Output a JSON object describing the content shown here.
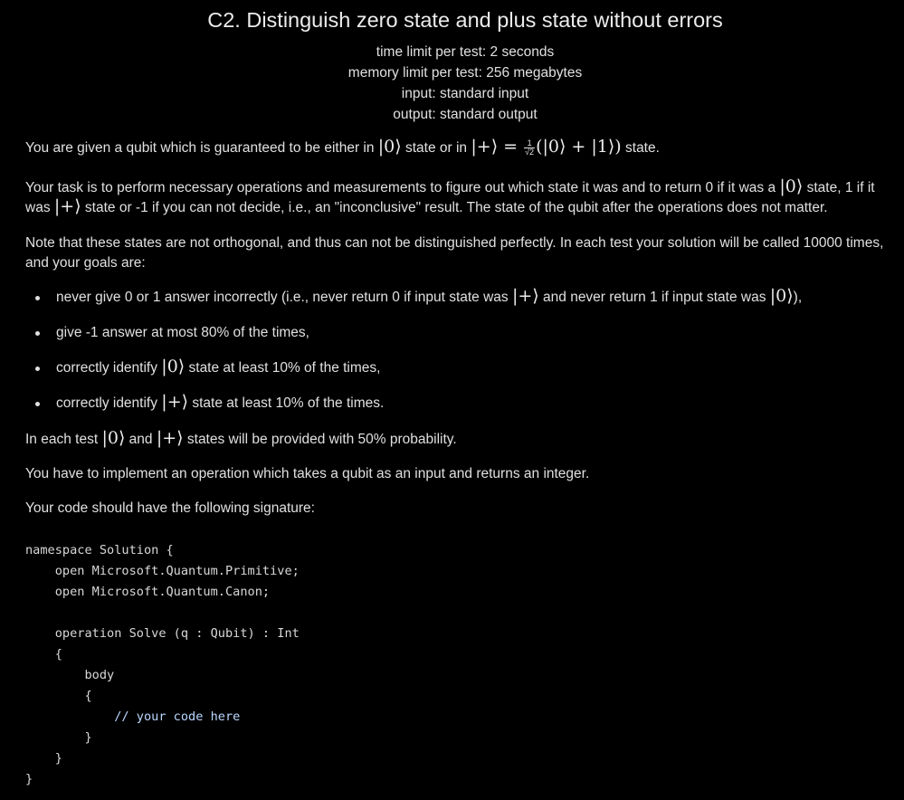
{
  "problem": {
    "title": "C2. Distinguish zero state and plus state without errors",
    "time_limit": "time limit per test: 2 seconds",
    "memory_limit": "memory limit per test: 256 megabytes",
    "input": "input: standard input",
    "output": "output: standard output"
  },
  "statement": {
    "p1": {
      "t1": "You are given a qubit which is guaranteed to be either in ",
      "m1": "|0⟩",
      "t2": " state or in ",
      "m2a": "|+⟩ = ",
      "frac_num": "1",
      "frac_den": "√2",
      "m2b": "(|0⟩ + |1⟩)",
      "t3": " state."
    },
    "p2": {
      "t1": "Your task is to perform necessary operations and measurements to figure out which state it was and to return 0 if it was a ",
      "m1": "|0⟩",
      "t2": " state, 1 if it was ",
      "m2": "|+⟩",
      "t3": " state or -1 if you can not decide, i.e., an \"inconclusive\" result. The state of the qubit after the operations does not matter."
    },
    "p3": "Note that these states are not orthogonal, and thus can not be distinguished perfectly. In each test your solution will be called 10000 times, and your goals are:",
    "goals": [
      {
        "t1": "never give 0 or 1 answer incorrectly (i.e., never return 0 if input state was ",
        "m1": "|+⟩",
        "t2": " and never return 1 if input state was ",
        "m2": "|0⟩",
        "t3": "),"
      },
      {
        "t1": "give -1 answer at most 80% of the times,"
      },
      {
        "t1": "correctly identify ",
        "m1": "|0⟩",
        "t2": " state at least 10% of the times,"
      },
      {
        "t1": "correctly identify ",
        "m1": "|+⟩",
        "t2": " state at least 10% of the times."
      }
    ],
    "p4": {
      "t1": "In each test ",
      "m1": "|0⟩",
      "t2": " and ",
      "m2": "|+⟩",
      "t3": " states will be provided with 50% probability."
    },
    "p5": "You have to implement an operation which takes a qubit as an input and returns an integer.",
    "p6": "Your code should have the following signature:"
  },
  "code": {
    "lines": [
      "namespace Solution {",
      "    open Microsoft.Quantum.Primitive;",
      "    open Microsoft.Quantum.Canon;",
      "",
      "    operation Solve (q : Qubit) : Int",
      "    {",
      "        body",
      "        {",
      "            // your code here",
      "        }",
      "    }",
      "}"
    ]
  },
  "colors": {
    "background": "#000000",
    "text": "#e0e0e0",
    "code_keyword": "#9ecbff"
  }
}
